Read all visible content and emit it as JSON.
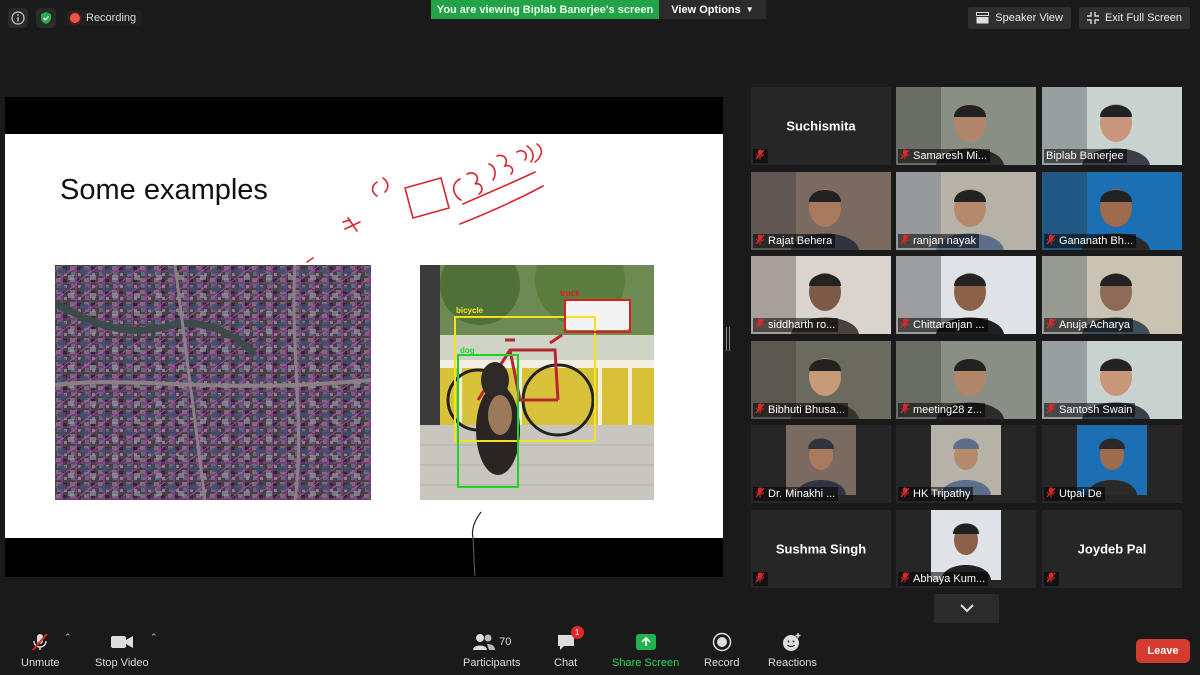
{
  "top_bar": {
    "recording_label": "Recording",
    "viewing_banner": "You are viewing Biplab Banerjee's screen",
    "view_options_label": "View Options",
    "speaker_view_label": "Speaker View",
    "exit_fullscreen_label": "Exit Full Screen"
  },
  "shared_screen": {
    "slide_title": "Some examples",
    "annotations": {
      "bicycle": "bicycle",
      "truck": "truck",
      "dog": "dog"
    }
  },
  "participants": [
    {
      "name": "Suchismita",
      "muted": true,
      "video": false
    },
    {
      "name": "Samaresh Mi...",
      "muted": true,
      "video": true
    },
    {
      "name": "Biplab Banerjee",
      "muted": false,
      "video": true,
      "active_speaker": true
    },
    {
      "name": "Rajat Behera",
      "muted": true,
      "video": true
    },
    {
      "name": "ranjan nayak",
      "muted": true,
      "video": true
    },
    {
      "name": "Gananath Bh...",
      "muted": true,
      "video": true
    },
    {
      "name": "siddharth ro...",
      "muted": true,
      "video": true
    },
    {
      "name": "Chittaranjan ...",
      "muted": true,
      "video": true
    },
    {
      "name": "Anuja Acharya",
      "muted": true,
      "video": true
    },
    {
      "name": "Bibhuti Bhusa...",
      "muted": true,
      "video": true
    },
    {
      "name": "meeting28 z...",
      "muted": true,
      "video": true
    },
    {
      "name": "Santosh Swain",
      "muted": true,
      "video": true
    },
    {
      "name": "Dr. Minakhi ...",
      "muted": true,
      "video": true
    },
    {
      "name": "HK Tripathy",
      "muted": true,
      "video": true
    },
    {
      "name": "Utpal De",
      "muted": true,
      "video": true
    },
    {
      "name": "Sushma Singh",
      "muted": true,
      "video": false
    },
    {
      "name": "Abhaya Kum...",
      "muted": true,
      "video": true
    },
    {
      "name": "Joydeb Pal",
      "muted": true,
      "video": false
    }
  ],
  "toolbar": {
    "unmute_label": "Unmute",
    "stop_video_label": "Stop Video",
    "participants_label": "Participants",
    "participants_count": "70",
    "chat_label": "Chat",
    "chat_badge": "1",
    "share_screen_label": "Share Screen",
    "record_label": "Record",
    "reactions_label": "Reactions",
    "leave_label": "Leave"
  },
  "colors": {
    "accent_green": "#23a349",
    "active_speaker_border": "#c7d94d",
    "leave_red": "#d53a2e",
    "mute_red": "#e02828"
  }
}
